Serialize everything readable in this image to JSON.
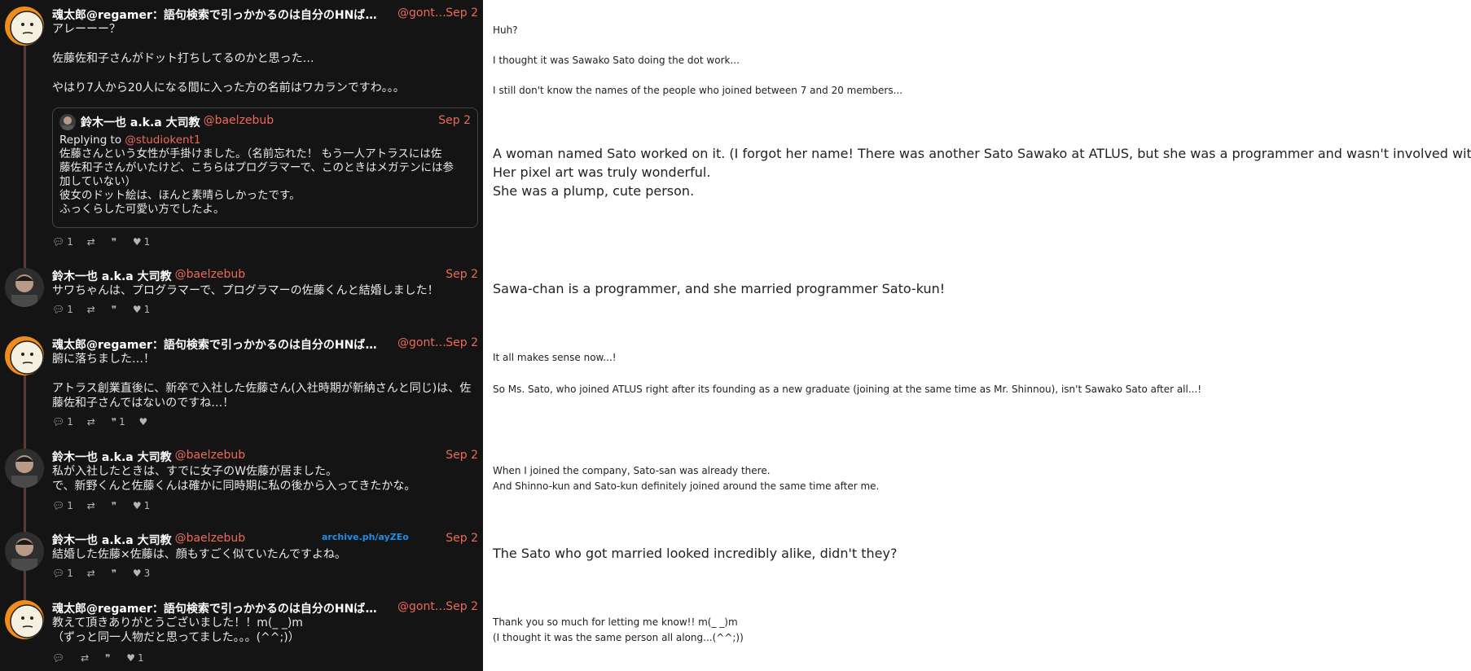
{
  "tweets": [
    {
      "name": "魂太郎@regamer：語句検索で引っかかるのは自分のHNばか…",
      "handle": "@gont…",
      "date": "Sep 2",
      "avatar_icon": "doodle-face-avatar",
      "lines": [
        "アレーーー？",
        "",
        "佐藤佐和子さんがドット打ちしてるのかと思った…",
        "",
        "やはり7人から20人になる間に入った方の名前はワカランですわ。。。"
      ],
      "quote": {
        "name": "鈴木一也 a.k.a 大司教",
        "handle": "@baelzebub",
        "date": "Sep 2",
        "reply_prefix": "Replying to",
        "reply_handle": "@studiokent1",
        "lines": [
          "佐藤さんという女性が手掛けました。（名前忘れた！ もう一人アトラスには佐",
          "藤佐和子さんがいたけど、こちらはプログラマーで、このときはメガテンには参",
          "加していない）",
          "彼女のドット絵は、ほんと素晴らしかったです。",
          "ふっくらした可愛い方でしたよ。"
        ]
      },
      "replies": "1",
      "retweets": "",
      "quotes": "",
      "likes": "1"
    },
    {
      "name": "鈴木一也 a.k.a 大司教",
      "handle": "@baelzebub",
      "date": "Sep 2",
      "avatar_icon": "man-photo-avatar",
      "lines": [
        "サワちゃんは、プログラマーで、プログラマーの佐藤くんと結婚しました！"
      ],
      "replies": "1",
      "retweets": "",
      "quotes": "",
      "likes": "1"
    },
    {
      "name": "魂太郎@regamer：語句検索で引っかかるのは自分のHNばか…",
      "handle": "@gont…",
      "date": "Sep 2",
      "avatar_icon": "doodle-face-avatar",
      "lines": [
        "腑に落ちました…！",
        "",
        "アトラス創業直後に、新卒で入社した佐藤さん(入社時期が新納さんと同じ)は、佐",
        "藤佐和子さんではないのですね…！"
      ],
      "replies": "1",
      "retweets": "",
      "quotes": "1",
      "likes": ""
    },
    {
      "name": "鈴木一也 a.k.a 大司教",
      "handle": "@baelzebub",
      "date": "Sep 2",
      "avatar_icon": "man-photo-avatar",
      "lines": [
        "私が入社したときは、すでに女子のW佐藤が居ました。",
        "で、新野くんと佐藤くんは確かに同時期に私の後から入ってきたかな。"
      ],
      "replies": "1",
      "retweets": "",
      "quotes": "",
      "likes": "1"
    },
    {
      "name": "鈴木一也 a.k.a 大司教",
      "handle": "@baelzebub",
      "date": "Sep 2",
      "avatar_icon": "man-photo-avatar",
      "lines": [
        "結婚した佐藤×佐藤は、顔もすごく似ていたんですよね。"
      ],
      "replies": "1",
      "retweets": "",
      "quotes": "",
      "likes": "3"
    },
    {
      "name": "魂太郎@regamer：語句検索で引っかかるのは自分のHNばか…",
      "handle": "@gont…",
      "date": "Sep 2",
      "avatar_icon": "doodle-face-avatar",
      "lines": [
        "教えて頂きありがとうございました！！m(_ _)m",
        "（ずっと同一人物だと思ってました。。。(^^;)）"
      ],
      "replies": "",
      "retweets": "",
      "quotes": "",
      "likes": "1"
    }
  ],
  "archive_link": "archive.ph/ayZEo",
  "translations": [
    {
      "size": "small",
      "lines": [
        "Huh?",
        "",
        "I thought it was Sawako Sato doing the dot work...",
        "",
        "I still don't know the names of the people who joined between 7 and 20 members..."
      ]
    },
    {
      "size": "big",
      "lines": [
        "A woman named Sato worked on it. (I forgot her name! There was another Sato Sawako at ATLUS, but she was a programmer and wasn't involved with MegaTen at that time.)",
        "Her pixel art was truly wonderful.",
        "She was a plump, cute person."
      ]
    },
    {
      "size": "big",
      "lines": [
        "Sawa-chan is a programmer, and she married programmer Sato-kun!"
      ]
    },
    {
      "size": "small",
      "lines": [
        "It all makes sense now...!",
        "",
        "So Ms. Sato, who joined ATLUS right after its founding as a new graduate (joining at the same time as Mr. Shinnou), isn't Sawako Sato after all...!"
      ]
    },
    {
      "size": "small",
      "lines": [
        "When I joined the company, Sato-san was already there.",
        "And Shinno-kun and Sato-kun definitely joined around the same time after me."
      ]
    },
    {
      "size": "big",
      "lines": [
        "The Sato who got married looked incredibly alike, didn't they?"
      ]
    },
    {
      "size": "small",
      "lines": [
        "Thank you so much for letting me know!! m(_ _)m",
        "(I thought it was the same person all along...(^^;))"
      ]
    }
  ],
  "colors": {
    "panel_bg": "#141414",
    "accent": "#ec6a58",
    "link": "#1e8fe8"
  }
}
